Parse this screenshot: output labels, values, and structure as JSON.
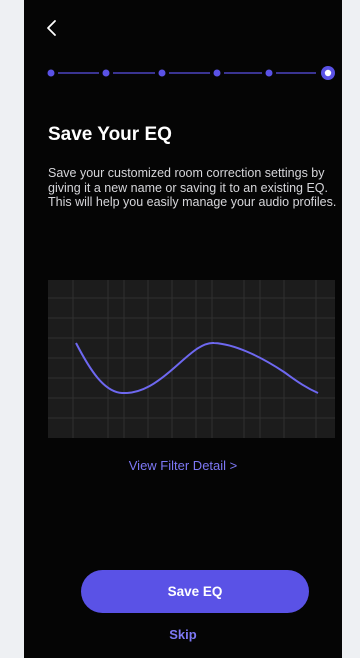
{
  "screen": {
    "back_icon": "chevron-left-icon",
    "steps": {
      "total": 6,
      "current": 6
    },
    "title": "Save Your EQ",
    "description": "Save your customized room correction settings by giving it a new name or saving it to an existing EQ. This will help you easily manage your audio profiles.",
    "view_filter_label": "View Filter Detail >",
    "save_label": "Save EQ",
    "skip_label": "Skip"
  },
  "colors": {
    "background": "#050505",
    "accent": "#5a52e6",
    "link": "#7d78f5",
    "curve": "#6e68f0",
    "chart_background": "#1c1c1c",
    "grid": "#303030"
  }
}
